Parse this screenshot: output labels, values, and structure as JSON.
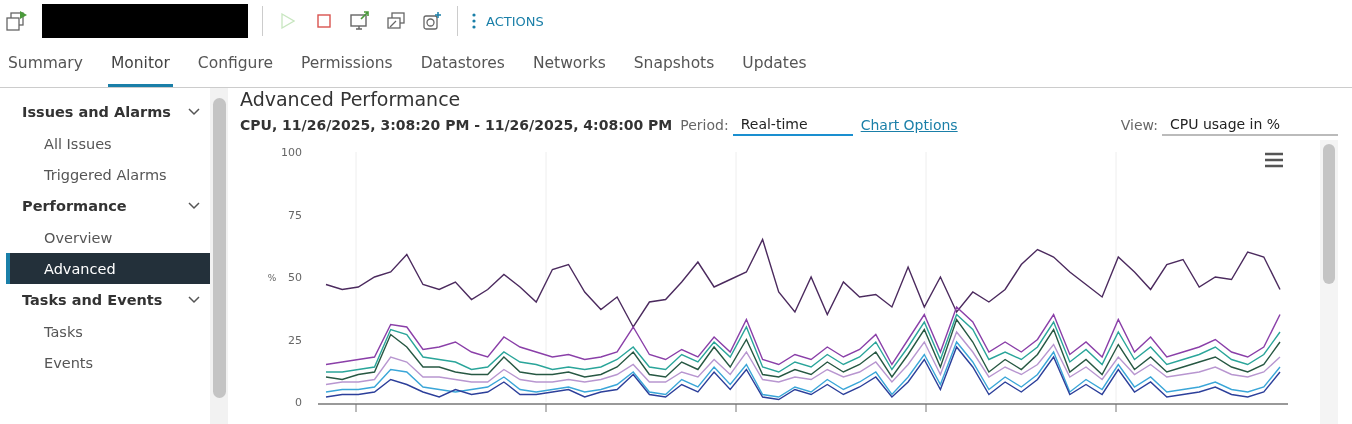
{
  "toolbar": {
    "buttons": [
      {
        "kind": "play",
        "disabled": true
      },
      {
        "kind": "stop",
        "disabled": false
      },
      {
        "kind": "console",
        "disabled": false
      },
      {
        "kind": "migrate",
        "disabled": false
      },
      {
        "kind": "snapshot",
        "disabled": false
      }
    ],
    "actions_label": "ACTIONS"
  },
  "tabs": [
    {
      "label": "Summary",
      "selected": false
    },
    {
      "label": "Monitor",
      "selected": true
    },
    {
      "label": "Configure",
      "selected": false
    },
    {
      "label": "Permissions",
      "selected": false
    },
    {
      "label": "Datastores",
      "selected": false
    },
    {
      "label": "Networks",
      "selected": false
    },
    {
      "label": "Snapshots",
      "selected": false
    },
    {
      "label": "Updates",
      "selected": false
    }
  ],
  "sidebar": {
    "sections": [
      {
        "label": "Issues and Alarms",
        "expanded": true,
        "items": [
          {
            "label": "All Issues",
            "selected": false
          },
          {
            "label": "Triggered Alarms",
            "selected": false
          }
        ]
      },
      {
        "label": "Performance",
        "expanded": true,
        "items": [
          {
            "label": "Overview",
            "selected": false
          },
          {
            "label": "Advanced",
            "selected": true
          }
        ]
      },
      {
        "label": "Tasks and Events",
        "expanded": true,
        "items": [
          {
            "label": "Tasks",
            "selected": false
          },
          {
            "label": "Events",
            "selected": false
          }
        ]
      }
    ]
  },
  "main": {
    "title": "Advanced Performance",
    "range": "CPU, 11/26/2025, 3:08:20 PM - 11/26/2025, 4:08:00 PM",
    "period_label": "Period:",
    "period_value": "Real-time",
    "chart_options_link": "Chart Options",
    "view_label": "View:",
    "view_value": "CPU usage in %",
    "chart_data": {
      "type": "line",
      "grid": true,
      "ylabel": "%",
      "ylim": [
        0,
        100
      ],
      "yticks": [
        0,
        25,
        50,
        75,
        100
      ],
      "series": [
        {
          "color": "#4b2a5e",
          "values": [
            47,
            45,
            46,
            50,
            52,
            59,
            47,
            45,
            48,
            41,
            45,
            51,
            46,
            40,
            53,
            55,
            44,
            37,
            42,
            30,
            40,
            41,
            48,
            56,
            46,
            49,
            52,
            65,
            44,
            36,
            50,
            35,
            48,
            42,
            43,
            38,
            54,
            38,
            50,
            36,
            44,
            40,
            45,
            55,
            61,
            58,
            52,
            47,
            42,
            58,
            52,
            45,
            55,
            57,
            46,
            50,
            49,
            60,
            58,
            45
          ]
        },
        {
          "color": "#8a3fa8",
          "values": [
            15,
            16,
            17,
            18,
            31,
            30,
            21,
            22,
            24,
            20,
            18,
            26,
            22,
            20,
            18,
            19,
            17,
            18,
            20,
            30,
            19,
            17,
            21,
            18,
            26,
            20,
            33,
            17,
            15,
            19,
            17,
            22,
            18,
            21,
            27,
            15,
            25,
            35,
            20,
            38,
            32,
            20,
            24,
            20,
            25,
            35,
            19,
            24,
            18,
            33,
            20,
            26,
            18,
            20,
            22,
            25,
            20,
            18,
            22,
            35
          ]
        },
        {
          "color": "#2aa59a",
          "values": [
            12,
            12,
            13,
            14,
            29,
            27,
            18,
            17,
            16,
            13,
            14,
            20,
            16,
            15,
            13,
            14,
            13,
            14,
            17,
            22,
            14,
            13,
            19,
            16,
            24,
            18,
            30,
            14,
            12,
            16,
            14,
            19,
            15,
            18,
            24,
            13,
            22,
            32,
            17,
            35,
            29,
            17,
            20,
            17,
            22,
            32,
            16,
            21,
            15,
            28,
            17,
            22,
            15,
            17,
            19,
            22,
            17,
            15,
            19,
            28
          ]
        },
        {
          "color": "#275843",
          "values": [
            10,
            9,
            11,
            12,
            27,
            22,
            14,
            14,
            12,
            11,
            11,
            18,
            12,
            11,
            11,
            12,
            10,
            11,
            14,
            20,
            11,
            10,
            16,
            13,
            22,
            14,
            25,
            11,
            10,
            13,
            11,
            16,
            12,
            15,
            20,
            10,
            19,
            29,
            14,
            33,
            24,
            12,
            17,
            13,
            19,
            29,
            12,
            17,
            11,
            23,
            13,
            18,
            12,
            14,
            16,
            18,
            14,
            12,
            15,
            24
          ]
        },
        {
          "color": "#b896d0",
          "values": [
            7,
            8,
            8,
            9,
            18,
            16,
            10,
            10,
            9,
            8,
            8,
            13,
            9,
            8,
            8,
            9,
            8,
            9,
            11,
            15,
            8,
            8,
            12,
            10,
            17,
            11,
            20,
            9,
            8,
            10,
            9,
            13,
            10,
            12,
            16,
            8,
            15,
            24,
            11,
            28,
            20,
            10,
            14,
            11,
            15,
            23,
            10,
            14,
            9,
            18,
            11,
            15,
            10,
            11,
            12,
            14,
            11,
            10,
            12,
            18
          ]
        },
        {
          "color": "#3aa6d8",
          "values": [
            4,
            5,
            5,
            6,
            13,
            12,
            6,
            5,
            4,
            5,
            6,
            10,
            5,
            4,
            5,
            6,
            4,
            5,
            7,
            12,
            4,
            3,
            9,
            6,
            14,
            7,
            15,
            3,
            2,
            6,
            4,
            9,
            5,
            8,
            12,
            3,
            10,
            19,
            7,
            24,
            16,
            5,
            10,
            6,
            11,
            20,
            4,
            9,
            5,
            15,
            6,
            10,
            4,
            5,
            6,
            8,
            5,
            4,
            6,
            14
          ]
        },
        {
          "color": "#2c3f9a",
          "values": [
            2,
            3,
            3,
            4,
            9,
            7,
            4,
            2,
            5,
            3,
            4,
            8,
            3,
            3,
            4,
            5,
            2,
            4,
            5,
            11,
            3,
            2,
            7,
            4,
            12,
            5,
            13,
            2,
            1,
            5,
            3,
            7,
            3,
            6,
            10,
            2,
            8,
            17,
            5,
            22,
            14,
            3,
            8,
            4,
            9,
            18,
            3,
            7,
            3,
            13,
            4,
            8,
            2,
            3,
            4,
            6,
            3,
            2,
            4,
            12
          ]
        }
      ]
    }
  }
}
